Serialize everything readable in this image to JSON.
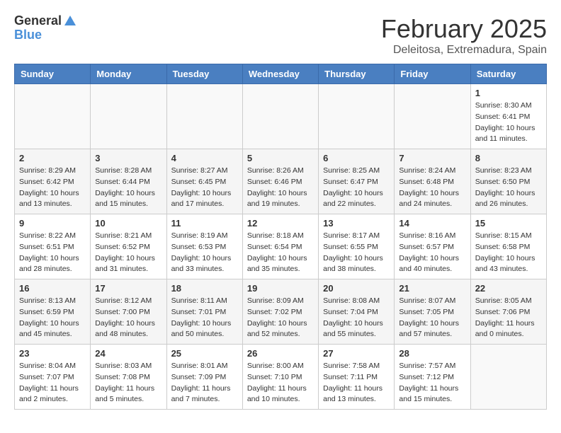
{
  "header": {
    "logo": {
      "general": "General",
      "blue": "Blue"
    },
    "title": "February 2025",
    "location": "Deleitosa, Extremadura, Spain"
  },
  "calendar": {
    "weekdays": [
      "Sunday",
      "Monday",
      "Tuesday",
      "Wednesday",
      "Thursday",
      "Friday",
      "Saturday"
    ],
    "weeks": [
      [
        {
          "day": "",
          "info": ""
        },
        {
          "day": "",
          "info": ""
        },
        {
          "day": "",
          "info": ""
        },
        {
          "day": "",
          "info": ""
        },
        {
          "day": "",
          "info": ""
        },
        {
          "day": "",
          "info": ""
        },
        {
          "day": "1",
          "info": "Sunrise: 8:30 AM\nSunset: 6:41 PM\nDaylight: 10 hours\nand 11 minutes."
        }
      ],
      [
        {
          "day": "2",
          "info": "Sunrise: 8:29 AM\nSunset: 6:42 PM\nDaylight: 10 hours\nand 13 minutes."
        },
        {
          "day": "3",
          "info": "Sunrise: 8:28 AM\nSunset: 6:44 PM\nDaylight: 10 hours\nand 15 minutes."
        },
        {
          "day": "4",
          "info": "Sunrise: 8:27 AM\nSunset: 6:45 PM\nDaylight: 10 hours\nand 17 minutes."
        },
        {
          "day": "5",
          "info": "Sunrise: 8:26 AM\nSunset: 6:46 PM\nDaylight: 10 hours\nand 19 minutes."
        },
        {
          "day": "6",
          "info": "Sunrise: 8:25 AM\nSunset: 6:47 PM\nDaylight: 10 hours\nand 22 minutes."
        },
        {
          "day": "7",
          "info": "Sunrise: 8:24 AM\nSunset: 6:48 PM\nDaylight: 10 hours\nand 24 minutes."
        },
        {
          "day": "8",
          "info": "Sunrise: 8:23 AM\nSunset: 6:50 PM\nDaylight: 10 hours\nand 26 minutes."
        }
      ],
      [
        {
          "day": "9",
          "info": "Sunrise: 8:22 AM\nSunset: 6:51 PM\nDaylight: 10 hours\nand 28 minutes."
        },
        {
          "day": "10",
          "info": "Sunrise: 8:21 AM\nSunset: 6:52 PM\nDaylight: 10 hours\nand 31 minutes."
        },
        {
          "day": "11",
          "info": "Sunrise: 8:19 AM\nSunset: 6:53 PM\nDaylight: 10 hours\nand 33 minutes."
        },
        {
          "day": "12",
          "info": "Sunrise: 8:18 AM\nSunset: 6:54 PM\nDaylight: 10 hours\nand 35 minutes."
        },
        {
          "day": "13",
          "info": "Sunrise: 8:17 AM\nSunset: 6:55 PM\nDaylight: 10 hours\nand 38 minutes."
        },
        {
          "day": "14",
          "info": "Sunrise: 8:16 AM\nSunset: 6:57 PM\nDaylight: 10 hours\nand 40 minutes."
        },
        {
          "day": "15",
          "info": "Sunrise: 8:15 AM\nSunset: 6:58 PM\nDaylight: 10 hours\nand 43 minutes."
        }
      ],
      [
        {
          "day": "16",
          "info": "Sunrise: 8:13 AM\nSunset: 6:59 PM\nDaylight: 10 hours\nand 45 minutes."
        },
        {
          "day": "17",
          "info": "Sunrise: 8:12 AM\nSunset: 7:00 PM\nDaylight: 10 hours\nand 48 minutes."
        },
        {
          "day": "18",
          "info": "Sunrise: 8:11 AM\nSunset: 7:01 PM\nDaylight: 10 hours\nand 50 minutes."
        },
        {
          "day": "19",
          "info": "Sunrise: 8:09 AM\nSunset: 7:02 PM\nDaylight: 10 hours\nand 52 minutes."
        },
        {
          "day": "20",
          "info": "Sunrise: 8:08 AM\nSunset: 7:04 PM\nDaylight: 10 hours\nand 55 minutes."
        },
        {
          "day": "21",
          "info": "Sunrise: 8:07 AM\nSunset: 7:05 PM\nDaylight: 10 hours\nand 57 minutes."
        },
        {
          "day": "22",
          "info": "Sunrise: 8:05 AM\nSunset: 7:06 PM\nDaylight: 11 hours\nand 0 minutes."
        }
      ],
      [
        {
          "day": "23",
          "info": "Sunrise: 8:04 AM\nSunset: 7:07 PM\nDaylight: 11 hours\nand 2 minutes."
        },
        {
          "day": "24",
          "info": "Sunrise: 8:03 AM\nSunset: 7:08 PM\nDaylight: 11 hours\nand 5 minutes."
        },
        {
          "day": "25",
          "info": "Sunrise: 8:01 AM\nSunset: 7:09 PM\nDaylight: 11 hours\nand 7 minutes."
        },
        {
          "day": "26",
          "info": "Sunrise: 8:00 AM\nSunset: 7:10 PM\nDaylight: 11 hours\nand 10 minutes."
        },
        {
          "day": "27",
          "info": "Sunrise: 7:58 AM\nSunset: 7:11 PM\nDaylight: 11 hours\nand 13 minutes."
        },
        {
          "day": "28",
          "info": "Sunrise: 7:57 AM\nSunset: 7:12 PM\nDaylight: 11 hours\nand 15 minutes."
        },
        {
          "day": "",
          "info": ""
        }
      ]
    ]
  }
}
